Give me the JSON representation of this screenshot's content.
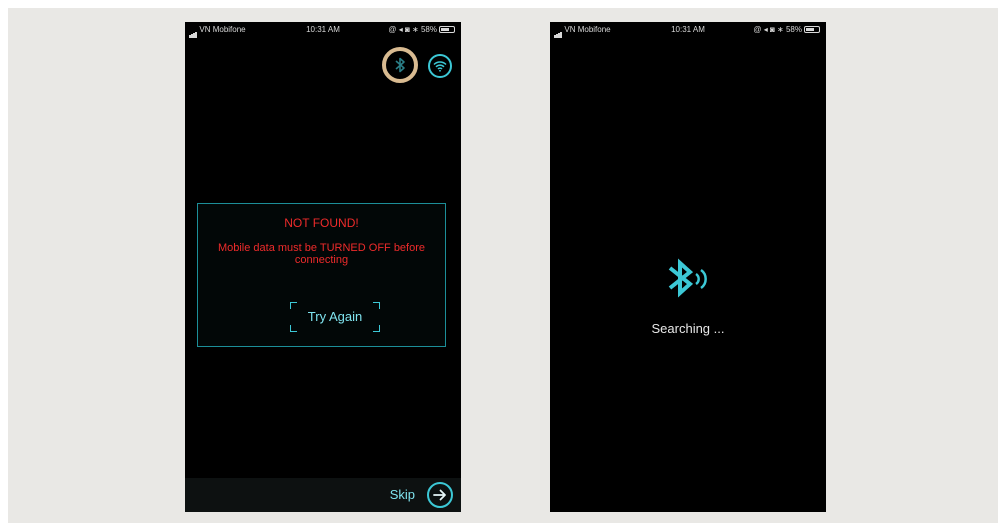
{
  "left_phone": {
    "status": {
      "carrier": "VN Mobifone",
      "time": "10:31 AM",
      "battery": "58%"
    },
    "icons": {
      "bluetooth": "bluetooth-icon",
      "wifi": "wifi-icon"
    },
    "dialog": {
      "title": "NOT FOUND!",
      "message": "Mobile data must be TURNED OFF before connecting",
      "button_label": "Try Again"
    },
    "footer": {
      "skip_label": "Skip",
      "skip_icon": "arrow-right-icon"
    }
  },
  "right_phone": {
    "status": {
      "carrier": "VN Mobifone",
      "time": "10:31 AM",
      "battery": "58%"
    },
    "icon": "bluetooth-searching-icon",
    "searching_text": "Searching ..."
  },
  "colors": {
    "accent": "#3cc8d6",
    "error": "#ee2b2b",
    "highlight_ring": "#d9bb91",
    "background": "#e9e8e5"
  }
}
